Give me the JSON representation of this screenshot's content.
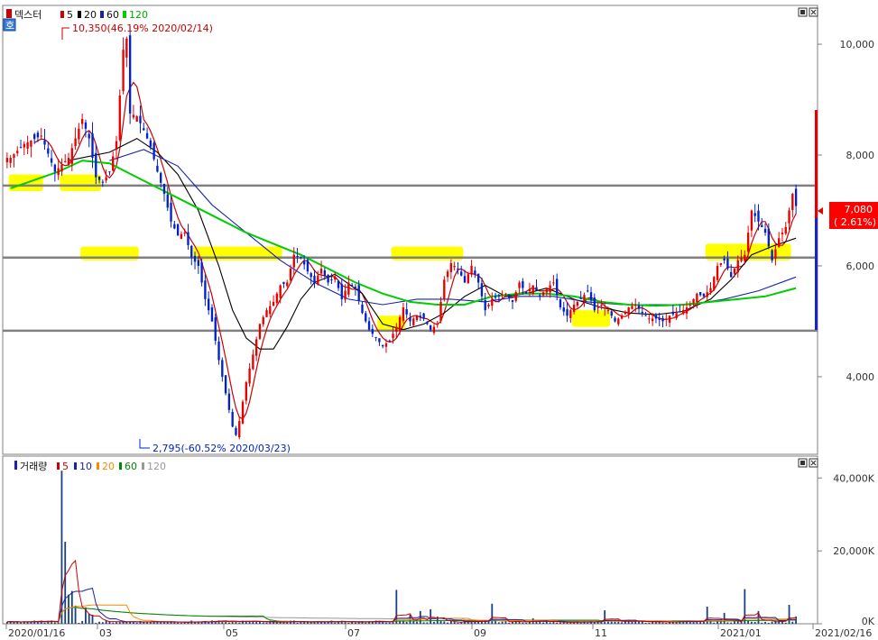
{
  "colors": {
    "up": "#e60000",
    "down": "#0022cc",
    "ma5": "#cc0000",
    "ma20": "#000000",
    "ma60": "#1a22aa",
    "ma120": "#00cc00",
    "hline": "#808080",
    "highlight": "#ffff00",
    "vol_ma5": "#cc0000",
    "vol_ma10": "#1a22aa",
    "vol_ma20": "#ff8800",
    "vol_ma60": "#008800",
    "vol_ma120": "#999999"
  },
  "price_panel": {
    "legend": {
      "title": "덱스터",
      "ma": [
        "5",
        "20",
        "60",
        "120"
      ]
    },
    "corner_badge": "호",
    "high_annotation": "10,350(46.19% 2020/02/14)",
    "low_annotation": "2,795(-60.52% 2020/03/23)",
    "current_price": "7,080",
    "current_change": "( 2.61%)",
    "yticks": [
      "10,000",
      "8,000",
      "6,000",
      "4,000"
    ]
  },
  "volume_panel": {
    "legend": {
      "title": "거래량",
      "ma": [
        "5",
        "10",
        "20",
        "60",
        "120"
      ]
    },
    "yticks": [
      "40,000K",
      "20,000K",
      "0K"
    ]
  },
  "xticks": [
    "2020/01/16",
    "03",
    "05",
    "07",
    "09",
    "11",
    "2021/01",
    "2021/02/16"
  ],
  "chart_data": {
    "type": "candlestick",
    "price_axis": {
      "ylim": [
        2600,
        10700
      ],
      "ticks": [
        4000,
        6000,
        8000,
        10000
      ]
    },
    "volume_axis": {
      "ylim": [
        0,
        46000
      ],
      "unit": "K",
      "ticks": [
        0,
        20000,
        40000
      ]
    },
    "horizontal_lines": [
      7450,
      6150,
      4830
    ],
    "key_points": {
      "high": {
        "value": 10350,
        "date": "2020/02/14"
      },
      "low": {
        "value": 2795,
        "date": "2020/03/23"
      },
      "last": 7080
    },
    "price_path": [
      [
        1,
        7950
      ],
      [
        5,
        8200
      ],
      [
        10,
        8350
      ],
      [
        14,
        7700
      ],
      [
        18,
        7950
      ],
      [
        22,
        8650
      ],
      [
        24,
        8300
      ],
      [
        26,
        7600
      ],
      [
        28,
        7500
      ],
      [
        30,
        7700
      ],
      [
        32,
        8250
      ],
      [
        34,
        9900
      ],
      [
        35,
        10100
      ],
      [
        36,
        8750
      ],
      [
        38,
        8700
      ],
      [
        40,
        8450
      ],
      [
        42,
        8150
      ],
      [
        44,
        7700
      ],
      [
        46,
        7300
      ],
      [
        48,
        6800
      ],
      [
        50,
        6550
      ],
      [
        52,
        6600
      ],
      [
        54,
        6150
      ],
      [
        56,
        6000
      ],
      [
        58,
        5400
      ],
      [
        60,
        5000
      ],
      [
        62,
        4300
      ],
      [
        64,
        3700
      ],
      [
        66,
        3100
      ],
      [
        67,
        2950
      ],
      [
        68,
        3200
      ],
      [
        70,
        3900
      ],
      [
        72,
        4400
      ],
      [
        74,
        4950
      ],
      [
        76,
        5200
      ],
      [
        78,
        5350
      ],
      [
        80,
        5650
      ],
      [
        82,
        5700
      ],
      [
        84,
        6200
      ],
      [
        86,
        6150
      ],
      [
        88,
        5900
      ],
      [
        90,
        5700
      ],
      [
        92,
        5950
      ],
      [
        94,
        5700
      ],
      [
        96,
        5800
      ],
      [
        98,
        5400
      ],
      [
        100,
        5700
      ],
      [
        102,
        5600
      ],
      [
        104,
        5150
      ],
      [
        106,
        4850
      ],
      [
        108,
        4700
      ],
      [
        110,
        4550
      ],
      [
        112,
        4650
      ],
      [
        114,
        4900
      ],
      [
        116,
        5250
      ],
      [
        118,
        5000
      ],
      [
        120,
        5100
      ],
      [
        122,
        5050
      ],
      [
        124,
        4850
      ],
      [
        126,
        4950
      ],
      [
        128,
        5750
      ],
      [
        130,
        6050
      ],
      [
        132,
        5950
      ],
      [
        134,
        5700
      ],
      [
        136,
        6000
      ],
      [
        138,
        5700
      ],
      [
        140,
        5200
      ],
      [
        142,
        5400
      ],
      [
        144,
        5450
      ],
      [
        146,
        5500
      ],
      [
        148,
        5350
      ],
      [
        150,
        5700
      ],
      [
        152,
        5500
      ],
      [
        154,
        5650
      ],
      [
        156,
        5450
      ],
      [
        158,
        5600
      ],
      [
        160,
        5700
      ],
      [
        162,
        5250
      ],
      [
        164,
        5100
      ],
      [
        166,
        5300
      ],
      [
        168,
        5400
      ],
      [
        170,
        5550
      ],
      [
        172,
        5200
      ],
      [
        174,
        5300
      ],
      [
        176,
        5200
      ],
      [
        178,
        5000
      ],
      [
        180,
        5100
      ],
      [
        182,
        5250
      ],
      [
        184,
        5300
      ],
      [
        186,
        5150
      ],
      [
        188,
        5050
      ],
      [
        190,
        5050
      ],
      [
        192,
        5000
      ],
      [
        194,
        5100
      ],
      [
        196,
        5150
      ],
      [
        198,
        5200
      ],
      [
        200,
        5300
      ],
      [
        202,
        5500
      ],
      [
        204,
        5450
      ],
      [
        206,
        5600
      ],
      [
        208,
        6000
      ],
      [
        210,
        6100
      ],
      [
        212,
        5800
      ],
      [
        214,
        6100
      ],
      [
        216,
        6200
      ],
      [
        218,
        7000
      ],
      [
        220,
        6800
      ],
      [
        222,
        6600
      ],
      [
        224,
        6100
      ],
      [
        226,
        6500
      ],
      [
        228,
        6700
      ],
      [
        230,
        7300
      ],
      [
        231,
        7080
      ]
    ],
    "ma20_path": [
      [
        18,
        7900
      ],
      [
        30,
        8050
      ],
      [
        38,
        8300
      ],
      [
        44,
        8050
      ],
      [
        50,
        7650
      ],
      [
        56,
        7000
      ],
      [
        62,
        6000
      ],
      [
        66,
        5200
      ],
      [
        70,
        4700
      ],
      [
        74,
        4500
      ],
      [
        78,
        4500
      ],
      [
        82,
        4900
      ],
      [
        86,
        5400
      ],
      [
        90,
        5700
      ],
      [
        96,
        5850
      ],
      [
        104,
        5500
      ],
      [
        110,
        4950
      ],
      [
        116,
        4850
      ],
      [
        122,
        4950
      ],
      [
        128,
        5150
      ],
      [
        134,
        5450
      ],
      [
        140,
        5650
      ],
      [
        146,
        5450
      ],
      [
        152,
        5500
      ],
      [
        158,
        5600
      ],
      [
        166,
        5400
      ],
      [
        174,
        5250
      ],
      [
        182,
        5150
      ],
      [
        190,
        5120
      ],
      [
        198,
        5180
      ],
      [
        206,
        5400
      ],
      [
        212,
        5750
      ],
      [
        218,
        6200
      ],
      [
        224,
        6350
      ],
      [
        231,
        6500
      ]
    ],
    "ma60_path": [
      [
        30,
        7900
      ],
      [
        40,
        8100
      ],
      [
        50,
        7800
      ],
      [
        60,
        7100
      ],
      [
        70,
        6600
      ],
      [
        80,
        6100
      ],
      [
        90,
        5700
      ],
      [
        100,
        5400
      ],
      [
        110,
        5300
      ],
      [
        120,
        5400
      ],
      [
        130,
        5400
      ],
      [
        140,
        5350
      ],
      [
        150,
        5450
      ],
      [
        160,
        5450
      ],
      [
        170,
        5350
      ],
      [
        180,
        5300
      ],
      [
        190,
        5300
      ],
      [
        200,
        5300
      ],
      [
        210,
        5400
      ],
      [
        220,
        5550
      ],
      [
        231,
        5800
      ]
    ],
    "ma120_path": [
      [
        1,
        7400
      ],
      [
        8,
        7550
      ],
      [
        15,
        7700
      ],
      [
        22,
        7900
      ],
      [
        30,
        7850
      ],
      [
        38,
        7600
      ],
      [
        46,
        7350
      ],
      [
        54,
        7100
      ],
      [
        62,
        6850
      ],
      [
        70,
        6600
      ],
      [
        78,
        6400
      ],
      [
        86,
        6200
      ],
      [
        94,
        5950
      ],
      [
        102,
        5700
      ],
      [
        110,
        5500
      ],
      [
        118,
        5350
      ],
      [
        126,
        5300
      ],
      [
        134,
        5300
      ],
      [
        142,
        5450
      ],
      [
        150,
        5500
      ],
      [
        158,
        5500
      ],
      [
        166,
        5450
      ],
      [
        174,
        5350
      ],
      [
        182,
        5300
      ],
      [
        190,
        5280
      ],
      [
        198,
        5300
      ],
      [
        206,
        5350
      ],
      [
        214,
        5400
      ],
      [
        222,
        5450
      ],
      [
        231,
        5600
      ]
    ],
    "highlight_zones": [
      {
        "from": 1,
        "to": 10,
        "low": 7350,
        "high": 7650
      },
      {
        "from": 16,
        "to": 27,
        "low": 7350,
        "high": 7650
      },
      {
        "from": 22,
        "to": 38,
        "low": 6100,
        "high": 6350
      },
      {
        "from": 55,
        "to": 80,
        "low": 6100,
        "high": 6350
      },
      {
        "from": 113,
        "to": 133,
        "low": 6100,
        "high": 6350
      },
      {
        "from": 109,
        "to": 116,
        "low": 4830,
        "high": 5100
      },
      {
        "from": 166,
        "to": 176,
        "low": 4900,
        "high": 5200
      },
      {
        "from": 205,
        "to": 229,
        "low": 6100,
        "high": 6400
      }
    ],
    "volume_spikes": [
      [
        16,
        42000
      ],
      [
        17,
        22500
      ],
      [
        18,
        8000
      ],
      [
        19,
        9000
      ],
      [
        20,
        5000
      ],
      [
        23,
        4500
      ],
      [
        24,
        2800
      ],
      [
        25,
        2500
      ],
      [
        62,
        900
      ],
      [
        114,
        9300
      ],
      [
        118,
        2500
      ],
      [
        121,
        3500
      ],
      [
        124,
        4000
      ],
      [
        126,
        2000
      ],
      [
        142,
        5500
      ],
      [
        154,
        1500
      ],
      [
        175,
        3700
      ],
      [
        205,
        4700
      ],
      [
        210,
        3000
      ],
      [
        216,
        9500
      ],
      [
        220,
        3500
      ],
      [
        229,
        5200
      ],
      [
        231,
        2000
      ]
    ]
  }
}
